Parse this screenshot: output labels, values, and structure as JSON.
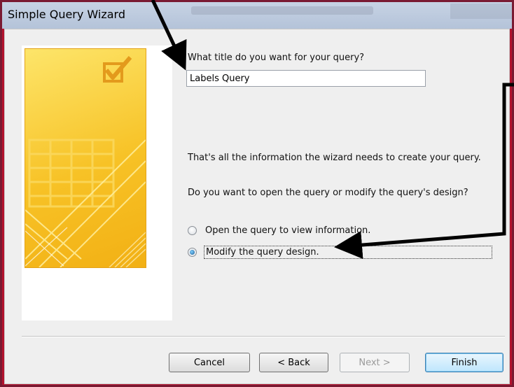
{
  "window": {
    "title": "Simple Query Wizard"
  },
  "form": {
    "title_prompt": "What title do you want for your query?",
    "query_title": "Labels Query",
    "info_text": "That's all the information the wizard needs to create your query.",
    "open_or_modify_prompt": "Do you want to open the query or modify the query's design?"
  },
  "options": [
    {
      "label": "Open the query to view information.",
      "checked": false
    },
    {
      "label": "Modify the query design.",
      "checked": true
    }
  ],
  "buttons": {
    "cancel": "Cancel",
    "back": "< Back",
    "next": "Next >",
    "finish": "Finish"
  },
  "colors": {
    "border": "#b3132e",
    "banner": "#f7c226",
    "annotation_arrow": "#000000"
  },
  "icons": {
    "banner_graphic": "wizard-checkmark-illustration"
  }
}
